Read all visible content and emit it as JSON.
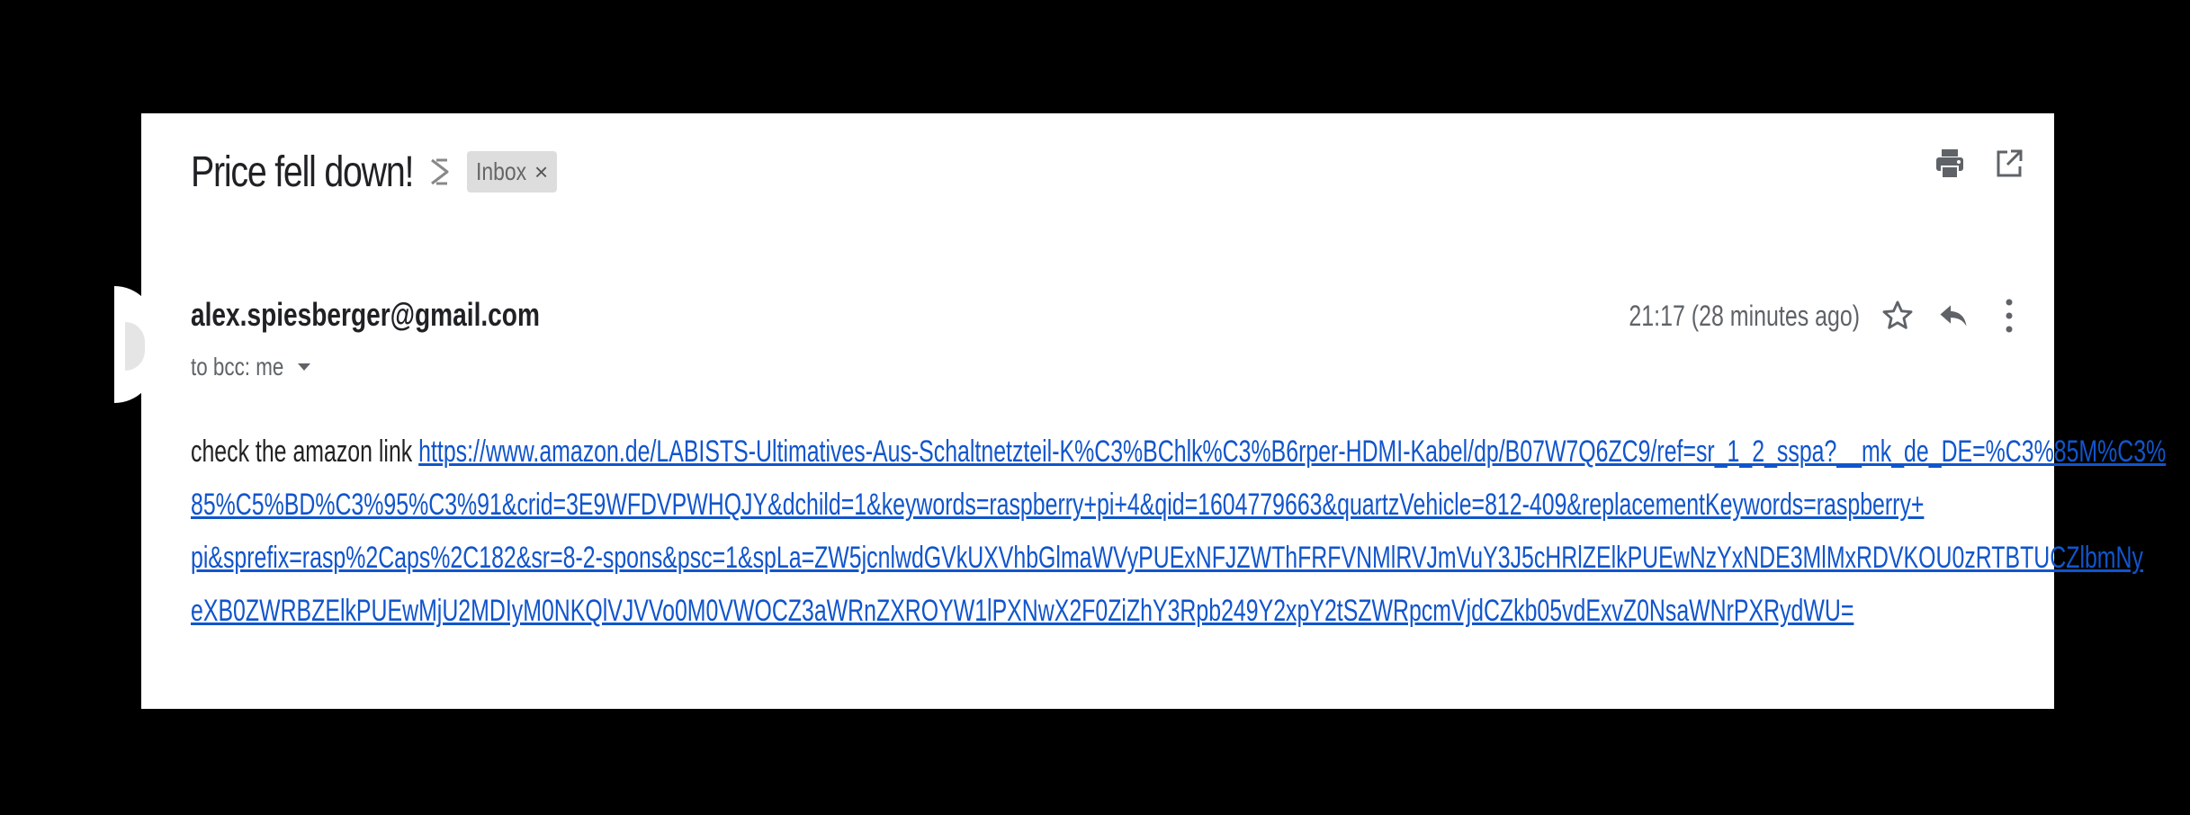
{
  "email": {
    "subject": "Price fell down!",
    "label": "Inbox",
    "label_close": "×",
    "sender": "alex.spiesberger@gmail.com",
    "timestamp": "21:17 (28 minutes ago)",
    "recipients": "to bcc: me",
    "body_prefix": "check the amazon link ",
    "link_lines": [
      "https://www.amazon.de/LABISTS-Ultimatives-Aus-Schaltnetzteil-K%C3%BChlk%C3%B6rper-HDMI-Kabel/dp/B07W7Q6ZC9/ref=sr_1_2_sspa?__mk_de_DE=%C3%85M%C3%",
      "85%C5%BD%C3%95%C3%91&crid=3E9WFDVPWHQJY&dchild=1&keywords=raspberry+pi+4&qid=1604779663&quartzVehicle=812-409&replacementKeywords=raspberry+",
      "pi&sprefix=rasp%2Caps%2C182&sr=8-2-spons&psc=1&spLa=ZW5jcnlwdGVkUXVhbGlmaWVyPUExNFJZWThFRFVNMlRVJmVuY3J5cHRlZElkPUEwNzYxNDE3MlMxRDVKOU0zRTBTUCZlbmNy",
      "eXB0ZWRBZElkPUEwMjU2MDIyM0NKQlVJVVo0M0VWOCZ3aWRnZXROYW1lPXNwX2F0ZiZhY3Rpb249Y2xpY2tSZWRpcmVjdCZkb05vdExvZ0NsaWNrPXRydWU="
    ]
  },
  "colors": {
    "background": "#000000",
    "card": "#ffffff",
    "link": "#1155cc",
    "chip": "#dddddd"
  },
  "icons": {
    "importance": "importance-marker-icon",
    "print": "print-icon",
    "new_window": "open-in-new-window-icon",
    "star": "star-icon",
    "reply": "reply-icon",
    "more": "more-vertical-icon"
  }
}
